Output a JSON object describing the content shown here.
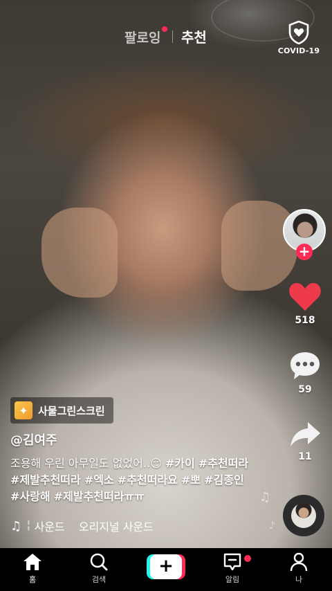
{
  "header": {
    "tab_following": "팔로잉",
    "tab_for_you": "추천",
    "covid_label": "COVID-19",
    "following_has_new": true
  },
  "right_rail": {
    "likes": "518",
    "comments": "59",
    "shares": "11",
    "follow_symbol": "+"
  },
  "post": {
    "effect_label": "사물그린스크린",
    "username": "@김여주",
    "caption_text": "조용해 우린 아무일도 없었어..😏",
    "hashtags": [
      "#카이",
      "#추천떠라",
      "#제발추천떠라",
      "#엑소",
      "#추천떠라요",
      "#뽀",
      "#김종인",
      "#사랑해",
      "#제발추천떠라ㅠㅠ"
    ],
    "sound_prefix": "╏",
    "sound_name": "사운드",
    "sound_original": "오리지널 사운드"
  },
  "bottom_nav": {
    "home": "홈",
    "search": "검색",
    "create": "+",
    "inbox": "알림",
    "me": "나",
    "inbox_has_new": true
  },
  "colors": {
    "accent_red": "#fe2c55",
    "accent_cyan": "#25f4ee",
    "like_red": "#ee3a4a"
  },
  "icons": [
    "shield-heart-icon",
    "heart-icon",
    "comment-icon",
    "share-icon",
    "music-note-icon",
    "home-icon",
    "search-icon",
    "plus-icon",
    "inbox-icon",
    "profile-icon"
  ]
}
